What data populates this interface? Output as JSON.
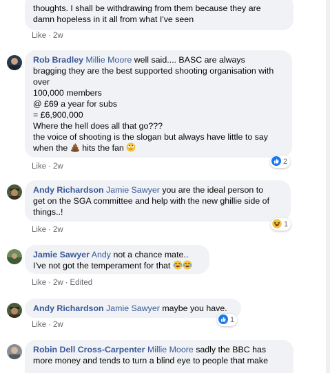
{
  "comments": [
    {
      "lines": [
        "thoughts. I shall be withdrawing from them because they are",
        "damn hopeless in it all from what I've seen"
      ],
      "like": "Like",
      "time": "2w"
    },
    {
      "author": "Rob Bradley",
      "tag": "Millie Moore",
      "first": "well said.... BASC are always",
      "lines": [
        "bragging they are the best supported shooting organisation with",
        "over",
        "100,000 members",
        "@ £69 a year for subs",
        "= £6,900,000",
        "Where the hell does all that go???",
        "the voice of shooting is the slogan but always have little to say"
      ],
      "last_a": "when the",
      "last_b": "hits the fan",
      "like": "Like",
      "time": "2w",
      "reaction_count": "2"
    },
    {
      "author": "Andy Richardson",
      "tag": "Jamie Sawyer",
      "first": "you are the ideal person to",
      "lines": [
        "get on the SGA committee and help with the new ghillie side of",
        "things..!"
      ],
      "like": "Like",
      "time": "2w",
      "reaction_count": "1"
    },
    {
      "author": "Jamie Sawyer",
      "tag": "Andy",
      "first": "not a chance mate..",
      "last": "I've not got the temperament for that",
      "like": "Like",
      "time": "2w",
      "edited": "Edited"
    },
    {
      "author": "Andy Richardson",
      "tag": "Jamie Sawyer",
      "first": "maybe you have.",
      "like": "Like",
      "time": "2w",
      "reaction_count": "1"
    },
    {
      "author": "Robin Dell Cross-Carpenter",
      "tag": "Millie Moore",
      "first": "sadly the BBC has",
      "lines": [
        "more money and tends to turn a blind eye to people that make"
      ]
    }
  ],
  "dot": "·",
  "colors": {
    "link": "#385898",
    "bubble": "#f0f2f5",
    "meta": "#65676b",
    "like_blue": "#1877f2"
  },
  "icons": [
    "poop-emoji-icon",
    "rolling-eyes-emoji-icon",
    "like-reaction-icon",
    "haha-reaction-icon",
    "tears-of-joy-emoji-icon"
  ]
}
